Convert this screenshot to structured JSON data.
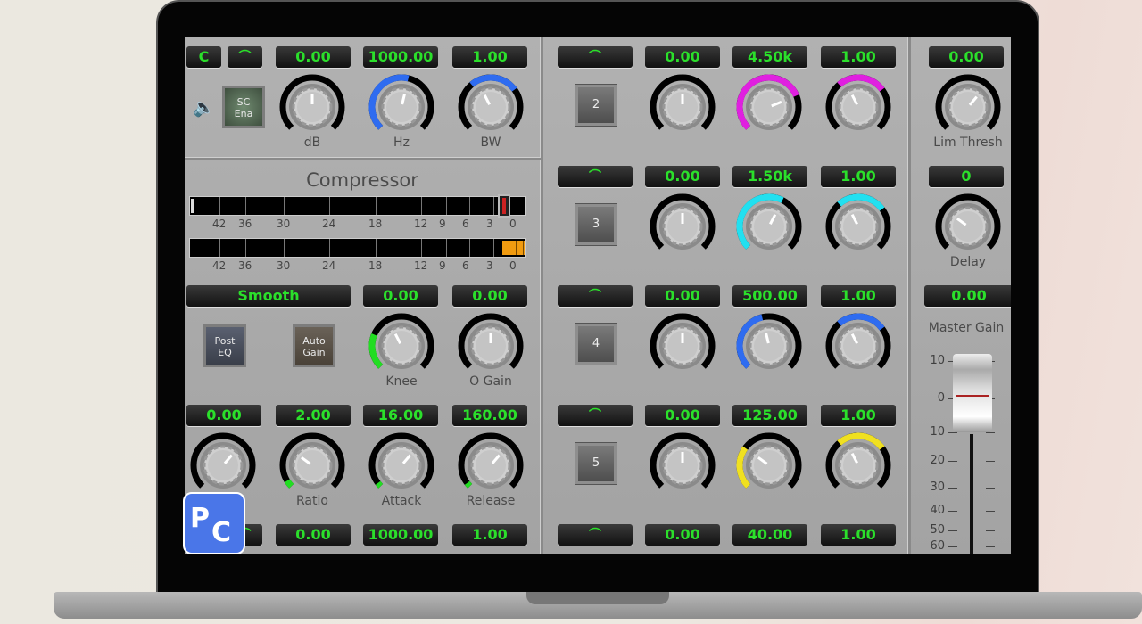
{
  "left": {
    "row1": {
      "mode": "C",
      "curve": "⌒",
      "gain": "0.00",
      "freq": "1000.00",
      "bw": "1.00"
    },
    "sc_button": {
      "line1": "SC",
      "line2": "Ena"
    },
    "compressor_title": "Compressor",
    "meter_scale": [
      "42",
      "36",
      "30",
      "24",
      "18",
      "12",
      "9",
      "6",
      "3",
      "0"
    ],
    "row2": {
      "mode": "Smooth",
      "knee": "0.00",
      "ogain": "0.00"
    },
    "post_eq": {
      "line1": "Post",
      "line2": "EQ"
    },
    "auto_gain": {
      "line1": "Auto",
      "line2": "Gain"
    },
    "row3": {
      "thresh": "0.00",
      "ratio": "2.00",
      "attack": "16.00",
      "release": "160.00"
    },
    "row4": {
      "curve": "⌒",
      "gain": "0.00",
      "freq": "1000.00",
      "bw": "1.00"
    }
  },
  "bands": [
    {
      "num": "2",
      "curve": "⌒",
      "gain": "0.00",
      "freq": "4.50k",
      "bw": "1.00"
    },
    {
      "num": "3",
      "curve": "⌒",
      "gain": "0.00",
      "freq": "1.50k",
      "bw": "1.00"
    },
    {
      "num": "4",
      "curve": "⌒",
      "gain": "0.00",
      "freq": "500.00",
      "bw": "1.00"
    },
    {
      "num": "5",
      "curve": "⌒",
      "gain": "0.00",
      "freq": "125.00",
      "bw": "1.00"
    },
    {
      "curve": "⌒",
      "gain": "0.00",
      "freq": "40.00",
      "bw": "1.00"
    }
  ],
  "right": {
    "lim_thresh": "0.00",
    "lim_label": "Lim Thresh",
    "delay": "0",
    "delay_label": "Delay",
    "master_gain": "0.00",
    "master_label": "Master Gain",
    "fader_scale": [
      "10",
      "0",
      "10",
      "20",
      "30",
      "40",
      "50",
      "60"
    ],
    "fader_value_db": 0
  },
  "knobs": [
    {
      "id": "db",
      "label": "dB",
      "color": "#000000",
      "arc": [
        0,
        0
      ],
      "value": 0.5
    },
    {
      "id": "hz",
      "label": "Hz",
      "color": "#2f6cf0",
      "arc": [
        0,
        0.55
      ],
      "value": 0.55
    },
    {
      "id": "bw",
      "label": "BW",
      "color": "#2f6cf0",
      "arc": [
        0.35,
        0.7
      ],
      "value": 0.4
    },
    {
      "id": "knee",
      "label": "Knee",
      "color": "#22dd22",
      "arc": [
        0,
        0.25
      ],
      "value": 0.4
    },
    {
      "id": "ogain",
      "label": "O Gain",
      "color": "#000000",
      "arc": [
        0,
        0
      ],
      "value": 0.5
    },
    {
      "id": "thresh",
      "label": "",
      "color": "#000000",
      "arc": [
        0,
        0
      ],
      "value": 0.65
    },
    {
      "id": "ratio",
      "label": "Ratio",
      "color": "#22dd22",
      "arc": [
        0,
        0.05
      ],
      "value": 0.3
    },
    {
      "id": "attack",
      "label": "Attack",
      "color": "#22dd22",
      "arc": [
        0,
        0.03
      ],
      "value": 0.65
    },
    {
      "id": "release",
      "label": "Release",
      "color": "#22dd22",
      "arc": [
        0,
        0.03
      ],
      "value": 0.65
    },
    {
      "id": "b2g",
      "label": "",
      "color": "#000000",
      "arc": [
        0,
        0
      ],
      "value": 0.5
    },
    {
      "id": "b2f",
      "label": "",
      "color": "#e020e0",
      "arc": [
        0,
        0.75
      ],
      "value": 0.75
    },
    {
      "id": "b2b",
      "label": "",
      "color": "#e020e0",
      "arc": [
        0.35,
        0.7
      ],
      "value": 0.4
    },
    {
      "id": "b3g",
      "label": "",
      "color": "#000000",
      "arc": [
        0,
        0
      ],
      "value": 0.5
    },
    {
      "id": "b3f",
      "label": "",
      "color": "#22e0f0",
      "arc": [
        0,
        0.6
      ],
      "value": 0.6
    },
    {
      "id": "b3b",
      "label": "",
      "color": "#22e0f0",
      "arc": [
        0.35,
        0.7
      ],
      "value": 0.4
    },
    {
      "id": "b4g",
      "label": "",
      "color": "#000000",
      "arc": [
        0,
        0
      ],
      "value": 0.5
    },
    {
      "id": "b4f",
      "label": "",
      "color": "#2f6cf0",
      "arc": [
        0,
        0.45
      ],
      "value": 0.45
    },
    {
      "id": "b4b",
      "label": "",
      "color": "#2f6cf0",
      "arc": [
        0.35,
        0.7
      ],
      "value": 0.4
    },
    {
      "id": "b5g",
      "label": "",
      "color": "#000000",
      "arc": [
        0,
        0
      ],
      "value": 0.5
    },
    {
      "id": "b5f",
      "label": "",
      "color": "#f0e020",
      "arc": [
        0,
        0.3
      ],
      "value": 0.3
    },
    {
      "id": "b5b",
      "label": "",
      "color": "#f0e020",
      "arc": [
        0.35,
        0.7
      ],
      "value": 0.4
    },
    {
      "id": "lim",
      "label": "Lim Thresh",
      "color": "#000000",
      "arc": [
        0,
        0
      ],
      "value": 0.65
    },
    {
      "id": "delay",
      "label": "Delay",
      "color": "#000000",
      "arc": [
        0,
        0
      ],
      "value": 0.3
    }
  ],
  "logo_text": "PC"
}
